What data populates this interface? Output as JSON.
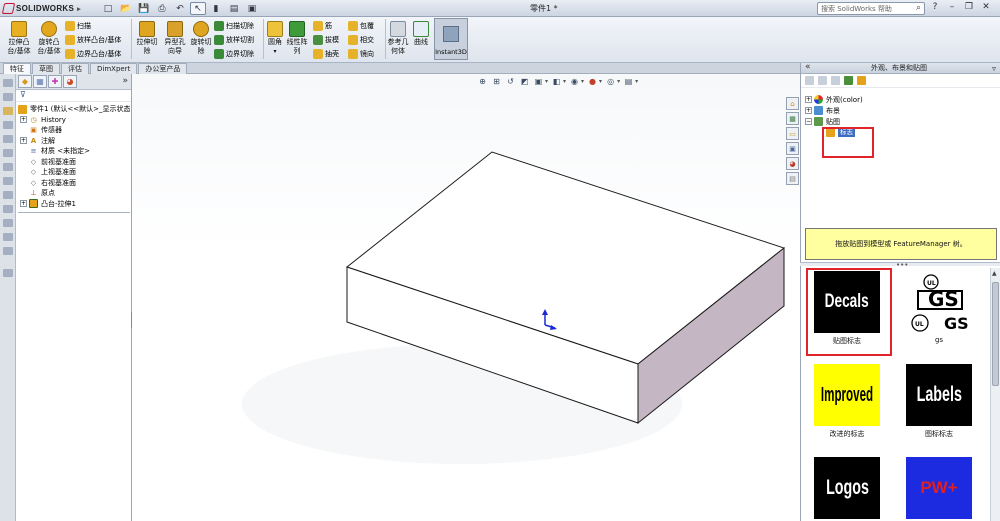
{
  "app": {
    "logo_text": "SOLIDWORKS",
    "document_title": "零件1 *",
    "search_placeholder": "搜索 SolidWorks 帮助"
  },
  "ribbon": {
    "big_buttons": [
      {
        "label": "拉伸凸\n台/基体"
      },
      {
        "label": "旋转凸\n台/基体"
      },
      {
        "label": "拉伸切\n除"
      },
      {
        "label": "异型孔\n向导"
      },
      {
        "label": "旋转切\n除"
      },
      {
        "label": "圆角"
      },
      {
        "label": "线性阵\n列"
      },
      {
        "label": "参考几\n何体"
      },
      {
        "label": "曲线"
      }
    ],
    "small_buttons": {
      "sweep": "扫描",
      "loft": "放样凸台/基体",
      "boundary_boss": "边界凸台/基体",
      "swept_cut": "扫描切除",
      "lofted_cut": "放样切割",
      "boundary_cut": "边界切除",
      "rib": "筋",
      "draft": "拔模",
      "shell": "抽壳",
      "wrap": "包覆",
      "intersect": "相交",
      "mirror": "镜向"
    },
    "instant3d": "Instant3D"
  },
  "tabs": [
    "特征",
    "草图",
    "评估",
    "DimXpert",
    "办公室产品"
  ],
  "feature_tree": {
    "root": "零件1 (默认<<默认>_显示状态",
    "items": [
      {
        "label": "History",
        "expandable": true
      },
      {
        "label": "传感器",
        "expandable": false
      },
      {
        "label": "注解",
        "expandable": true
      },
      {
        "label": "材质 <未指定>",
        "expandable": false
      },
      {
        "label": "前视基准面",
        "expandable": false
      },
      {
        "label": "上视基准面",
        "expandable": false
      },
      {
        "label": "右视基准面",
        "expandable": false
      },
      {
        "label": "原点",
        "expandable": false
      },
      {
        "label": "凸台-拉伸1",
        "expandable": true
      }
    ]
  },
  "task_pane": {
    "title": "外观、布景和贴图",
    "tree": [
      {
        "label": "外观(color)",
        "expanded": false
      },
      {
        "label": "布景",
        "expanded": false
      },
      {
        "label": "贴图",
        "expanded": true
      }
    ],
    "selected_child": "标志",
    "hint": "拖放贴图到模型或 FeatureManager 树。",
    "decals": [
      {
        "thumb_text": "Decals",
        "caption": "贴图标志",
        "bg": "#000000",
        "fg": "#ffffff"
      },
      {
        "thumb_text": "",
        "caption": "gs",
        "bg": "#ffffff",
        "fg": "#000000"
      },
      {
        "thumb_text": "Improved",
        "caption": "改进的标志",
        "bg": "#ffff00",
        "fg": "#000000"
      },
      {
        "thumb_text": "Labels",
        "caption": "图标标志",
        "bg": "#000000",
        "fg": "#ffffff"
      },
      {
        "thumb_text": "Logos",
        "caption": "",
        "bg": "#000000",
        "fg": "#ffffff"
      },
      {
        "thumb_text": "PW+",
        "caption": "",
        "bg": "#1d2be0",
        "fg": "#e02020"
      }
    ]
  },
  "colors": {
    "highlight_red": "#e0242a",
    "selection_blue": "#3d6cc0",
    "hint_yellow": "#ffffa0",
    "box_side": "#c4b6c3"
  }
}
